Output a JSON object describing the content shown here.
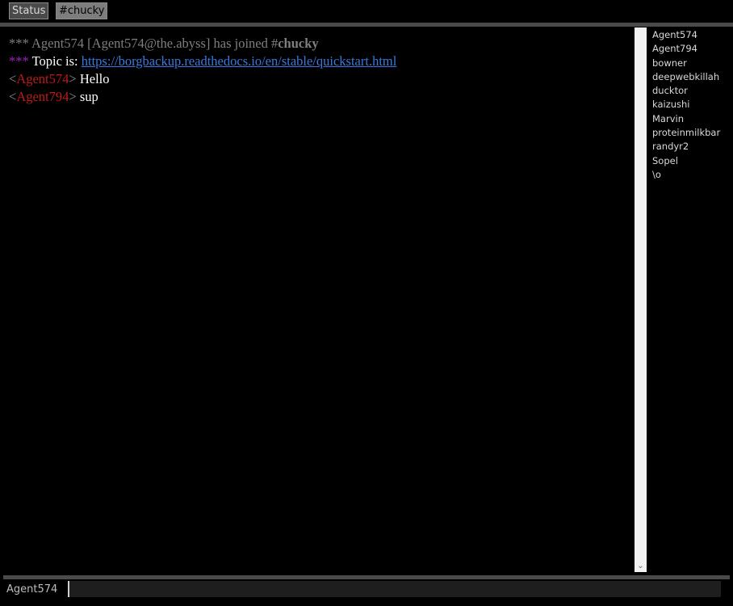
{
  "tabs": [
    {
      "label": "Status"
    },
    {
      "label": "#chucky"
    }
  ],
  "chat": {
    "join": {
      "stars": "***",
      "text": " Agent574 [Agent574@the.abyss] has joined #",
      "channel": "chucky"
    },
    "topic": {
      "stars": "***",
      "label": " Topic is: ",
      "url": "https://borgbackup.readthedocs.io/en/stable/quickstart.html"
    },
    "messages": [
      {
        "open": "<",
        "nick": "Agent574",
        "close": ">",
        "text": " Hello"
      },
      {
        "open": "<",
        "nick": "Agent794",
        "close": ">",
        "text": " sup"
      }
    ]
  },
  "scrollbar": {
    "down_arrow": "⌄"
  },
  "users": [
    "Agent574",
    "Agent794",
    "bowner",
    "deepwebkillah",
    "ducktor",
    "kaizushi",
    "Marvin",
    "proteinmilkbar",
    "randyr2",
    "Sopel",
    "\\o"
  ],
  "input": {
    "nick": "Agent574",
    "value": ""
  },
  "colors": {
    "background": "#000000",
    "nick": "#c21818",
    "link": "#3a78e0",
    "topic_stars": "#a020c0"
  }
}
